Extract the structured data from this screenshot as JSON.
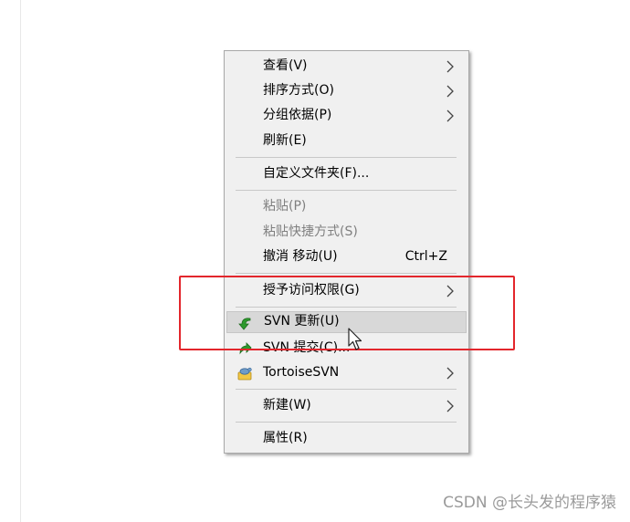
{
  "context_menu": {
    "items": [
      {
        "label": "查看(V)",
        "enabled": true,
        "has_submenu": true
      },
      {
        "label": "排序方式(O)",
        "enabled": true,
        "has_submenu": true
      },
      {
        "label": "分组依据(P)",
        "enabled": true,
        "has_submenu": true
      },
      {
        "label": "刷新(E)",
        "enabled": true,
        "has_submenu": false
      },
      {
        "label": "自定义文件夹(F)...",
        "enabled": true,
        "has_submenu": false
      },
      {
        "label": "粘贴(P)",
        "enabled": false,
        "has_submenu": false
      },
      {
        "label": "粘贴快捷方式(S)",
        "enabled": false,
        "has_submenu": false
      },
      {
        "label": "撤消 移动(U)",
        "shortcut": "Ctrl+Z",
        "enabled": true,
        "has_submenu": false
      },
      {
        "label": "授予访问权限(G)",
        "enabled": true,
        "has_submenu": true
      },
      {
        "label": "SVN 更新(U)",
        "enabled": true,
        "has_submenu": false,
        "icon": "svn-update-icon",
        "highlighted": true
      },
      {
        "label": "SVN 提交(C)...",
        "enabled": true,
        "has_submenu": false,
        "icon": "svn-commit-icon"
      },
      {
        "label": "TortoiseSVN",
        "enabled": true,
        "has_submenu": true,
        "icon": "tortoisesvn-icon"
      },
      {
        "label": "新建(W)",
        "enabled": true,
        "has_submenu": true
      },
      {
        "label": "属性(R)",
        "enabled": true,
        "has_submenu": false
      }
    ]
  },
  "annotation": {
    "box_color": "#e3262c"
  },
  "watermark": "CSDN @长头发的程序猿",
  "colors": {
    "menu_background": "#f0f0f0",
    "highlight": "#d8d8d8",
    "disabled_text": "#7f7f7f",
    "svn_green": "#2e9a2e"
  }
}
